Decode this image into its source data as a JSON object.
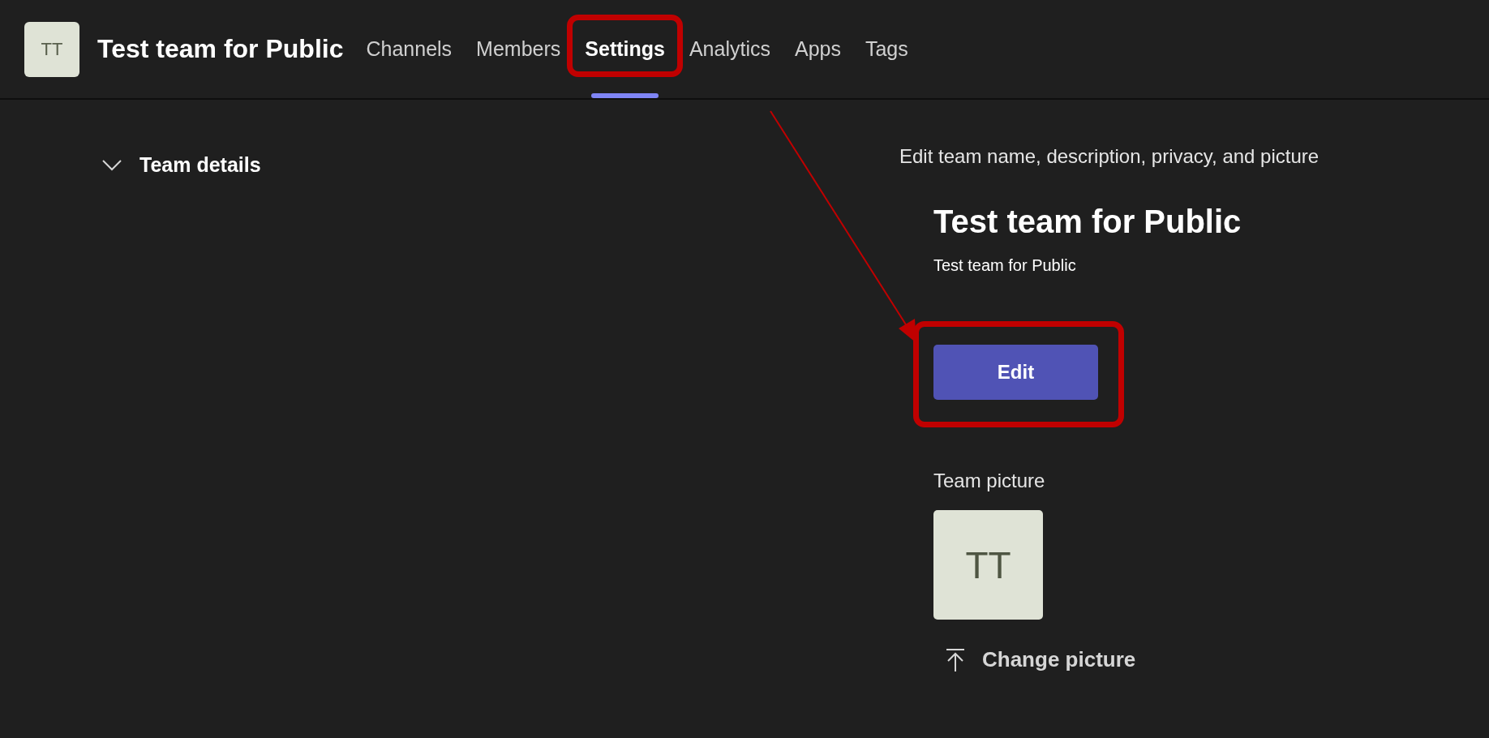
{
  "header": {
    "avatar": "TT",
    "team_name": "Test team for Public"
  },
  "tabs": [
    {
      "label": "Channels",
      "selected": false,
      "annotated": false
    },
    {
      "label": "Members",
      "selected": false,
      "annotated": false
    },
    {
      "label": "Settings",
      "selected": true,
      "annotated": true
    },
    {
      "label": "Analytics",
      "selected": false,
      "annotated": false
    },
    {
      "label": "Apps",
      "selected": false,
      "annotated": false
    },
    {
      "label": "Tags",
      "selected": false,
      "annotated": false
    }
  ],
  "section": {
    "title": "Team details",
    "expanded": true,
    "description": "Edit team name, description, privacy, and picture"
  },
  "team": {
    "name": "Test team for Public",
    "description": "Test team for Public"
  },
  "edit_button": {
    "label": "Edit",
    "annotated": true
  },
  "picture": {
    "label": "Team picture",
    "avatar": "TT",
    "change_label": "Change picture"
  }
}
